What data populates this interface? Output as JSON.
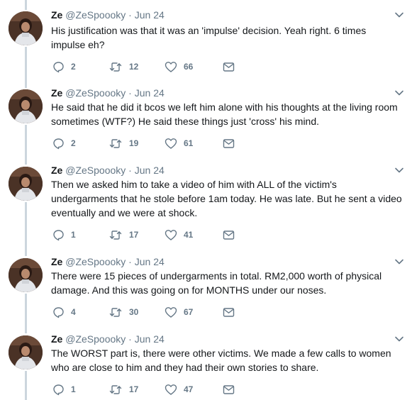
{
  "author": {
    "name": "Ze",
    "handle": "@ZeSpoooky",
    "separator": "·",
    "avatar_icon": "profile-photo"
  },
  "colors": {
    "text": "#14171a",
    "secondary": "#657786",
    "thread_line": "#ccd6dd"
  },
  "tweets": [
    {
      "date": "Jun 24",
      "lines": [
        "His justification was that it was an 'impulse' decision. Yeah right. 6 times",
        "impulse eh?"
      ],
      "replies": "2",
      "retweets": "12",
      "likes": "66"
    },
    {
      "date": "Jun 24",
      "lines": [
        "He said that he did it bcos we left him alone with his thoughts at the living room",
        "sometimes (WTF?) He said these things just 'cross' his mind."
      ],
      "replies": "2",
      "retweets": "19",
      "likes": "61"
    },
    {
      "date": "Jun 24",
      "lines": [
        "Then we asked him to take a video of him with ALL of the victim's",
        "undergarments that he stole before 1am today. He was late. But he sent a video",
        "eventually and we were at shock."
      ],
      "replies": "1",
      "retweets": "17",
      "likes": "41"
    },
    {
      "date": "Jun 24",
      "lines": [
        "There were 15 pieces of undergarments in total. RM2,000 worth of physical",
        "damage. And this was going on for MONTHS under our noses."
      ],
      "replies": "4",
      "retweets": "30",
      "likes": "67"
    },
    {
      "date": "Jun 24",
      "lines": [
        "The WORST part is, there were other victims. We made a few calls to women",
        "who are close to him and they had their own stories to share."
      ],
      "replies": "1",
      "retweets": "17",
      "likes": "47"
    }
  ]
}
